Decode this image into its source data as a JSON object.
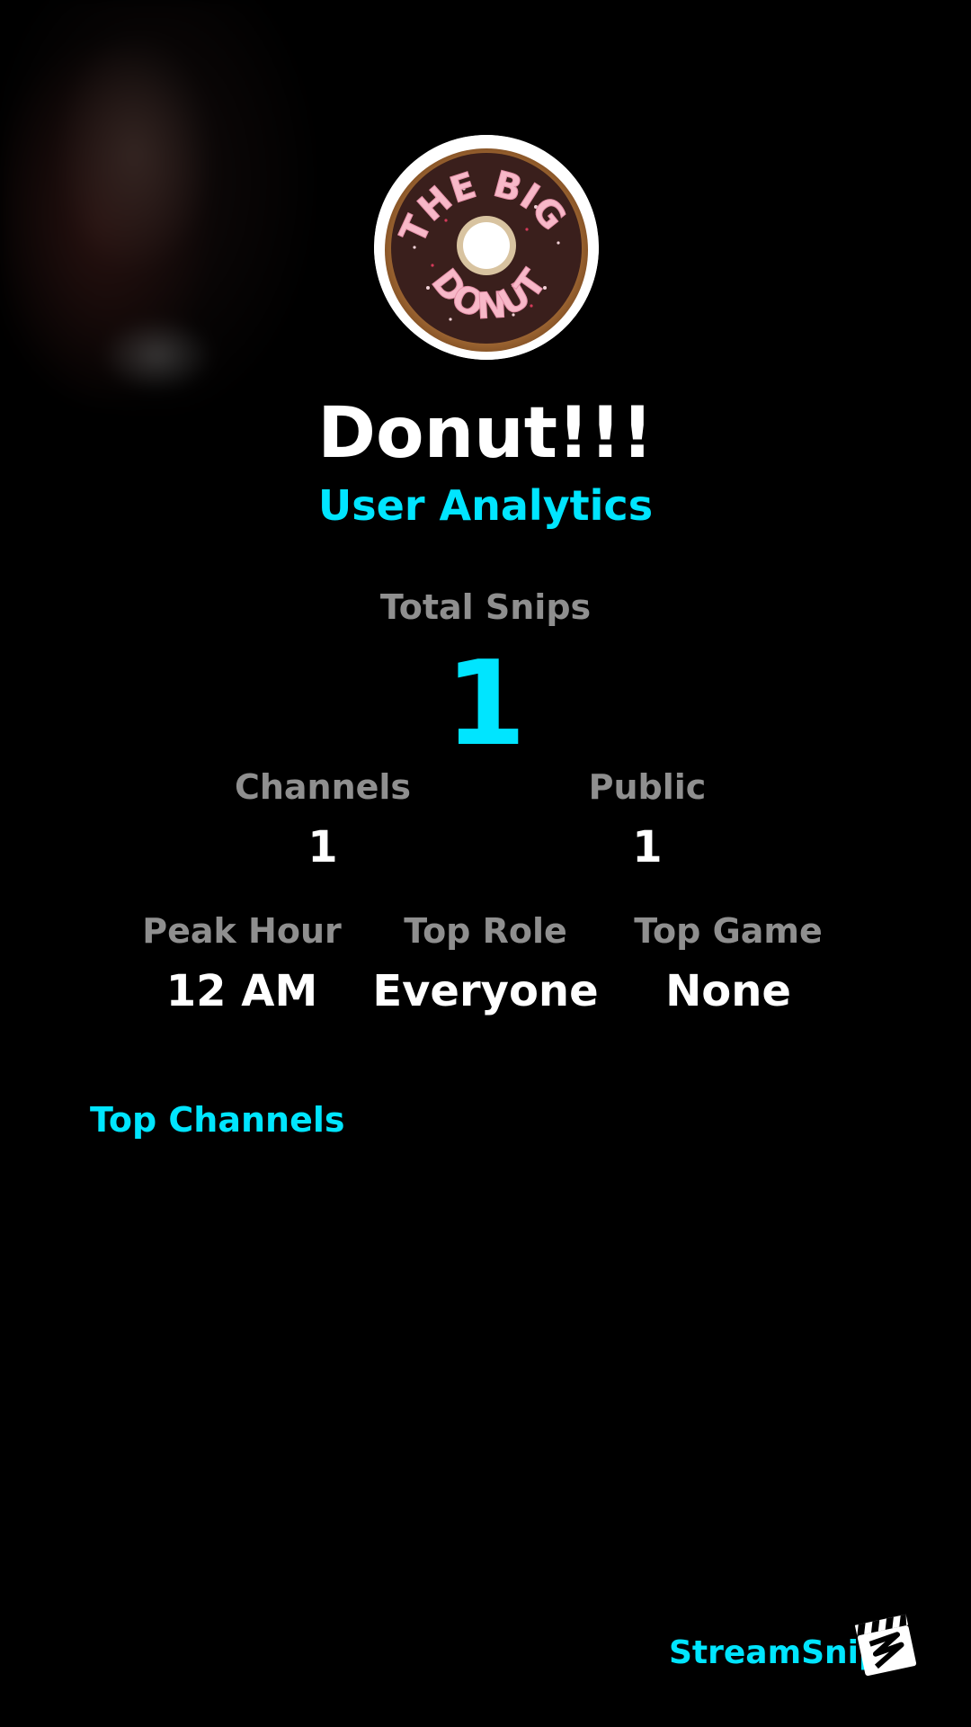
{
  "colors": {
    "accent": "#00e5ff",
    "label_gray": "#8f8f8f",
    "text": "#ffffff",
    "background": "#000000"
  },
  "profile": {
    "avatar_text_top": "THE BIG",
    "avatar_text_bottom": "DONUT",
    "username": "Donut!!!",
    "subtitle": "User Analytics"
  },
  "stats": {
    "total_snips_label": "Total Snips",
    "total_snips_value": "1",
    "channels_label": "Channels",
    "channels_value": "1",
    "public_label": "Public",
    "public_value": "1",
    "peak_hour_label": "Peak Hour",
    "peak_hour_value": "12 AM",
    "top_role_label": "Top Role",
    "top_role_value": "Everyone",
    "top_game_label": "Top Game",
    "top_game_value": "None"
  },
  "sections": {
    "top_channels_title": "Top Channels"
  },
  "branding": {
    "name": "StreamSnip",
    "logo_icon": "clapperboard-icon"
  }
}
